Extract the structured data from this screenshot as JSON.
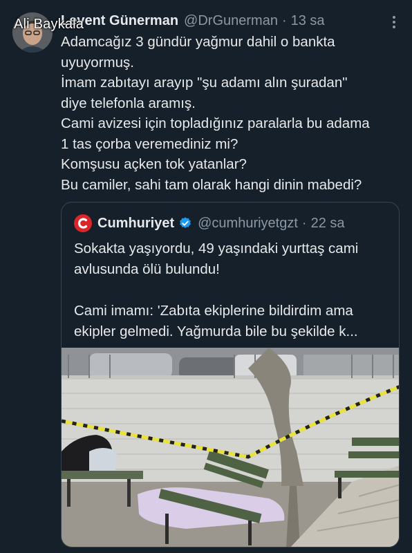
{
  "watermark": "Ali Baykala",
  "tweet": {
    "author_name": "Levent Günerman",
    "author_handle": "@DrGunerman",
    "separator": "·",
    "time": "13 sa",
    "lines": [
      "Adamcağız 3 gündür yağmur dahil o bankta",
      "uyuyormuş.",
      "İmam zabıtayı arayıp \"şu adamı alın şuradan\"",
      "diye telefonla aramış.",
      "Cami avizesi için topladığınız paralarla bu adama",
      "1 tas çorba veremediniz mi?",
      "Komşusu açken tok yatanlar?",
      "Bu camiler, sahi tam olarak hangi dinin mabedi?"
    ]
  },
  "quote": {
    "author_name": "Cumhuriyet",
    "author_handle": "@cumhuriyetgzt",
    "separator": "·",
    "time": "22 sa",
    "lines_1": [
      "Sokakta yaşıyordu, 49 yaşındaki yurttaş cami",
      "avlusunda ölü bulundu!"
    ],
    "lines_2": [
      "Cami imamı: 'Zabıta ekiplerine bildirdim ama",
      "ekipler gelmedi. Yağmurda bile bu şekilde k..."
    ]
  },
  "icons": {
    "more": "more-options-icon",
    "verified": "verified-badge-icon",
    "logo": "cumhuriyet-logo-icon"
  },
  "colors": {
    "background": "#15202b",
    "text": "#e7e9ea",
    "muted": "#8b98a5",
    "verified": "#1d9bf0",
    "brand_red": "#d8262b",
    "border": "#38444d"
  }
}
